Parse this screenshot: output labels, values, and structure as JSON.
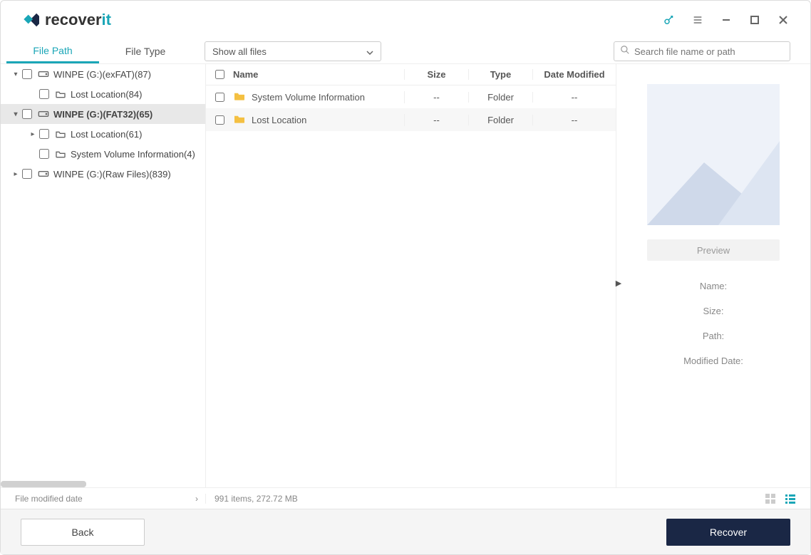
{
  "brand": {
    "text_dark": "recover",
    "text_teal": "it"
  },
  "titlebar": {
    "key_tip": "key-icon",
    "menu_tip": "menu-icon",
    "min_tip": "minimize",
    "max_tip": "maximize",
    "close_tip": "close"
  },
  "tabs": {
    "file_path": "File Path",
    "file_type": "File Type"
  },
  "filter": {
    "label": "Show all files"
  },
  "search": {
    "placeholder": "Search file name or path"
  },
  "tree": {
    "items": [
      {
        "indent": 0,
        "expand": "▾",
        "label": "WINPE (G:)(exFAT)(87)",
        "kind": "drive",
        "selected": false
      },
      {
        "indent": 1,
        "expand": "",
        "label": "Lost Location(84)",
        "kind": "folder",
        "selected": false
      },
      {
        "indent": 0,
        "expand": "▾",
        "label": "WINPE (G:)(FAT32)(65)",
        "kind": "drive",
        "selected": true
      },
      {
        "indent": 1,
        "expand": "▸",
        "label": "Lost Location(61)",
        "kind": "folder",
        "selected": false
      },
      {
        "indent": 1,
        "expand": "",
        "label": "System Volume Information(4)",
        "kind": "folder",
        "selected": false
      },
      {
        "indent": 0,
        "expand": "▸",
        "label": "WINPE (G:)(Raw Files)(839)",
        "kind": "drive",
        "selected": false
      }
    ]
  },
  "list": {
    "headers": {
      "name": "Name",
      "size": "Size",
      "type": "Type",
      "date": "Date Modified"
    },
    "rows": [
      {
        "name": "System Volume Information",
        "size": "--",
        "type": "Folder",
        "date": "--"
      },
      {
        "name": "Lost Location",
        "size": "--",
        "type": "Folder",
        "date": "--"
      }
    ]
  },
  "preview": {
    "button": "Preview",
    "meta": {
      "name": "Name:",
      "size": "Size:",
      "path": "Path:",
      "modified": "Modified Date:"
    }
  },
  "status": {
    "left": "File modified date",
    "mid": "991 items, 272.72  MB"
  },
  "footer": {
    "back": "Back",
    "recover": "Recover"
  }
}
